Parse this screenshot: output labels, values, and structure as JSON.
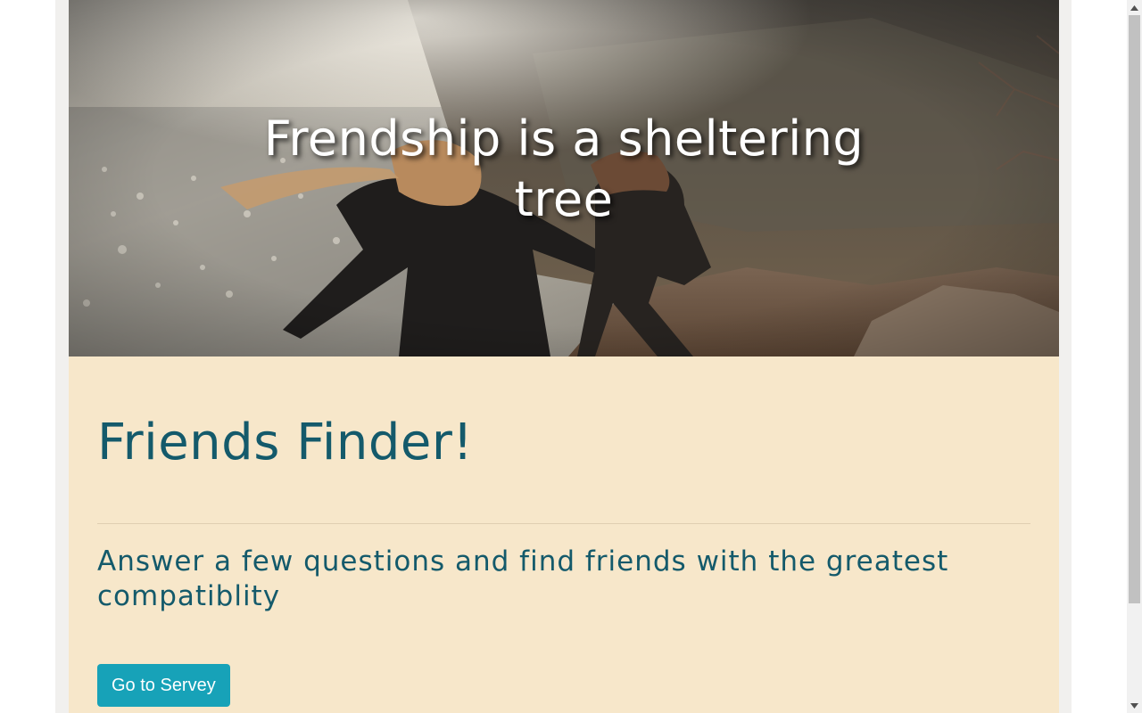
{
  "hero": {
    "title": "Frendship is a sheltering tree",
    "image_description_icon": "photo-two-friends-on-hillside"
  },
  "main": {
    "heading": "Friends Finder!",
    "subheading": "Answer a few questions and find friends with the greatest compatiblity",
    "cta_label": "Go to Servey"
  },
  "colors": {
    "heading_text": "#145a6b",
    "content_background": "#f7e7ca",
    "button_background": "#17a2b8",
    "button_text": "#ffffff",
    "outer_background": "#f1f0ee"
  },
  "scrollbar": {
    "up_icon": "triangle-up-icon",
    "down_icon": "triangle-down-icon"
  }
}
